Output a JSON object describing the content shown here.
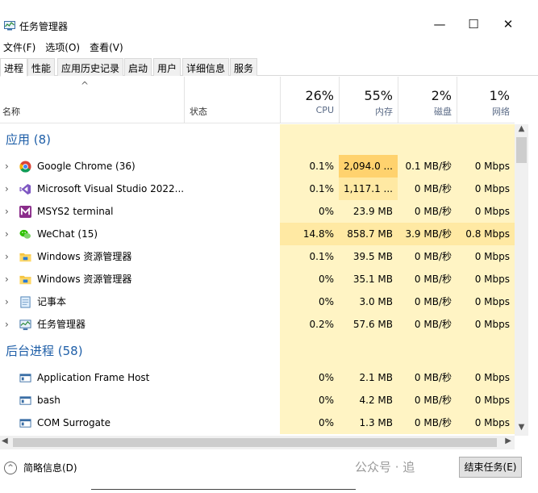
{
  "window": {
    "title": "任务管理器",
    "controls": {
      "minimize": "—",
      "maximize": "☐",
      "close": "✕"
    }
  },
  "menu": [
    "文件(F)",
    "选项(O)",
    "查看(V)"
  ],
  "tabs": [
    "进程",
    "性能",
    "应用历史记录",
    "启动",
    "用户",
    "详细信息",
    "服务"
  ],
  "columns": {
    "name": "名称",
    "status": "状态",
    "cpu": {
      "pct": "26%",
      "label": "CPU"
    },
    "memory": {
      "pct": "55%",
      "label": "内存"
    },
    "disk": {
      "pct": "2%",
      "label": "磁盘"
    },
    "network": {
      "pct": "1%",
      "label": "网络"
    }
  },
  "groups": {
    "apps": {
      "title": "应用 (8)",
      "rows": [
        {
          "name": "Google Chrome (36)",
          "icon": "chrome-icon",
          "cpu": "0.1%",
          "mem": "2,094.0 ...",
          "disk": "0.1 MB/秒",
          "net": "0 Mbps"
        },
        {
          "name": "Microsoft Visual Studio 2022...",
          "icon": "visual-studio-icon",
          "cpu": "0.1%",
          "mem": "1,117.1 ...",
          "disk": "0 MB/秒",
          "net": "0 Mbps"
        },
        {
          "name": "MSYS2 terminal",
          "icon": "msys2-icon",
          "cpu": "0%",
          "mem": "23.9 MB",
          "disk": "0 MB/秒",
          "net": "0 Mbps"
        },
        {
          "name": "WeChat (15)",
          "icon": "wechat-icon",
          "cpu": "14.8%",
          "mem": "858.7 MB",
          "disk": "3.9 MB/秒",
          "net": "0.8 Mbps"
        },
        {
          "name": "Windows 资源管理器",
          "icon": "file-explorer-icon",
          "cpu": "0.1%",
          "mem": "39.5 MB",
          "disk": "0 MB/秒",
          "net": "0 Mbps"
        },
        {
          "name": "Windows 资源管理器",
          "icon": "file-explorer-icon",
          "cpu": "0%",
          "mem": "35.1 MB",
          "disk": "0 MB/秒",
          "net": "0 Mbps"
        },
        {
          "name": "记事本",
          "icon": "notepad-icon",
          "cpu": "0%",
          "mem": "3.0 MB",
          "disk": "0 MB/秒",
          "net": "0 Mbps"
        },
        {
          "name": "任务管理器",
          "icon": "task-manager-icon",
          "cpu": "0.2%",
          "mem": "57.6 MB",
          "disk": "0 MB/秒",
          "net": "0 Mbps"
        }
      ]
    },
    "background": {
      "title": "后台进程 (58)",
      "rows": [
        {
          "name": "Application Frame Host",
          "icon": "app-window-icon",
          "cpu": "0%",
          "mem": "2.1 MB",
          "disk": "0 MB/秒",
          "net": "0 Mbps"
        },
        {
          "name": "bash",
          "icon": "app-window-icon",
          "cpu": "0%",
          "mem": "4.2 MB",
          "disk": "0 MB/秒",
          "net": "0 Mbps"
        },
        {
          "name": "COM Surrogate",
          "icon": "app-window-icon",
          "cpu": "0%",
          "mem": "1.3 MB",
          "disk": "0 MB/秒",
          "net": "0 Mbps"
        }
      ]
    }
  },
  "footer": {
    "fewer_details": "简略信息(D)",
    "end_task": "结束任务(E)",
    "watermark": "公众号 · 追"
  },
  "colors": {
    "heat_light": "#fff4c4",
    "heat_mid": "#ffe9a3",
    "heat_strong": "#ffd26e",
    "group_title": "#1f5fa8",
    "accent_blue": "#0078d7"
  }
}
